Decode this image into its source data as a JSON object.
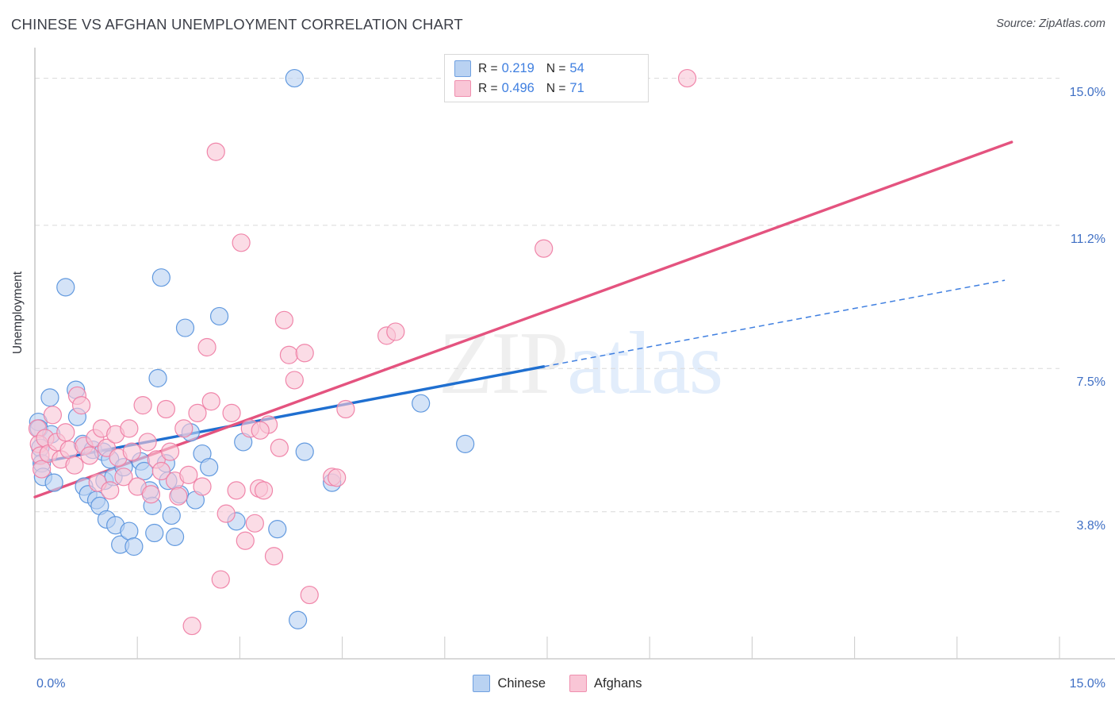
{
  "header": {
    "title": "CHINESE VS AFGHAN UNEMPLOYMENT CORRELATION CHART",
    "source": "Source: ZipAtlas.com"
  },
  "watermark": {
    "part1": "ZIP",
    "part2": "atlas"
  },
  "stats_legend": {
    "rows": [
      {
        "color": "#b9d2f2",
        "r_label": "R =",
        "r_value": "0.219",
        "n_label": "N =",
        "n_value": "54"
      },
      {
        "color": "#f9c6d6",
        "r_label": "R =",
        "r_value": "0.496",
        "n_label": "N =",
        "n_value": "71"
      }
    ]
  },
  "series_legend": {
    "items": [
      {
        "label": "Chinese",
        "color": "#b9d2f2"
      },
      {
        "label": "Afghans",
        "color": "#f9c6d6"
      }
    ]
  },
  "chart_data": {
    "type": "scatter",
    "title": "CHINESE VS AFGHAN UNEMPLOYMENT CORRELATION CHART",
    "xlabel": "",
    "ylabel": "Unemployment",
    "xlim": [
      0.0,
      15.0
    ],
    "ylim": [
      0.0,
      15.75
    ],
    "grid": true,
    "legend_position": "bottom-center",
    "x_tick_labels": [
      "0.0%",
      "15.0%"
    ],
    "y_tick_labels": [
      "3.8%",
      "7.5%",
      "11.2%",
      "15.0%"
    ],
    "y_tick_values": [
      3.8,
      7.5,
      11.2,
      15.0
    ],
    "series": [
      {
        "name": "Chinese",
        "color": "#b9d2f2",
        "stroke": "#5b95dd",
        "r": 0.219,
        "n": 54,
        "trendline": {
          "x0": 0.0,
          "y0": 5.05,
          "x1": 7.45,
          "y1": 7.55,
          "style": "solid",
          "color": "#1f6fd0"
        },
        "trendline_extension": {
          "x0": 7.45,
          "y0": 7.55,
          "x1": 14.2,
          "y1": 9.78,
          "style": "dashed",
          "color": "#3f7fe0"
        },
        "points": [
          {
            "x": 0.05,
            "y": 6.12
          },
          {
            "x": 0.06,
            "y": 5.95
          },
          {
            "x": 0.08,
            "y": 5.45
          },
          {
            "x": 0.1,
            "y": 5.05
          },
          {
            "x": 0.12,
            "y": 4.7
          },
          {
            "x": 0.22,
            "y": 6.75
          },
          {
            "x": 0.24,
            "y": 5.8
          },
          {
            "x": 0.28,
            "y": 4.55
          },
          {
            "x": 0.45,
            "y": 9.6
          },
          {
            "x": 0.6,
            "y": 6.95
          },
          {
            "x": 0.62,
            "y": 6.25
          },
          {
            "x": 0.7,
            "y": 5.55
          },
          {
            "x": 0.72,
            "y": 4.45
          },
          {
            "x": 0.78,
            "y": 4.25
          },
          {
            "x": 0.85,
            "y": 5.4
          },
          {
            "x": 0.9,
            "y": 4.1
          },
          {
            "x": 0.95,
            "y": 3.95
          },
          {
            "x": 1.0,
            "y": 5.35
          },
          {
            "x": 1.02,
            "y": 4.6
          },
          {
            "x": 1.05,
            "y": 3.6
          },
          {
            "x": 1.1,
            "y": 5.15
          },
          {
            "x": 1.15,
            "y": 4.7
          },
          {
            "x": 1.18,
            "y": 3.45
          },
          {
            "x": 1.25,
            "y": 2.95
          },
          {
            "x": 1.3,
            "y": 4.95
          },
          {
            "x": 1.38,
            "y": 3.3
          },
          {
            "x": 1.45,
            "y": 2.9
          },
          {
            "x": 1.55,
            "y": 5.1
          },
          {
            "x": 1.6,
            "y": 4.85
          },
          {
            "x": 1.68,
            "y": 4.35
          },
          {
            "x": 1.72,
            "y": 3.95
          },
          {
            "x": 1.75,
            "y": 3.25
          },
          {
            "x": 1.8,
            "y": 7.25
          },
          {
            "x": 1.85,
            "y": 9.85
          },
          {
            "x": 1.92,
            "y": 5.05
          },
          {
            "x": 1.95,
            "y": 4.6
          },
          {
            "x": 2.0,
            "y": 3.7
          },
          {
            "x": 2.05,
            "y": 3.15
          },
          {
            "x": 2.12,
            "y": 4.25
          },
          {
            "x": 2.2,
            "y": 8.55
          },
          {
            "x": 2.28,
            "y": 5.85
          },
          {
            "x": 2.35,
            "y": 4.1
          },
          {
            "x": 2.45,
            "y": 5.3
          },
          {
            "x": 2.55,
            "y": 4.95
          },
          {
            "x": 2.7,
            "y": 8.85
          },
          {
            "x": 2.95,
            "y": 3.55
          },
          {
            "x": 3.05,
            "y": 5.6
          },
          {
            "x": 3.55,
            "y": 3.35
          },
          {
            "x": 3.8,
            "y": 15.0
          },
          {
            "x": 3.85,
            "y": 1.0
          },
          {
            "x": 3.95,
            "y": 5.35
          },
          {
            "x": 4.35,
            "y": 4.55
          },
          {
            "x": 5.65,
            "y": 6.6
          },
          {
            "x": 6.3,
            "y": 5.55
          }
        ]
      },
      {
        "name": "Afghans",
        "color": "#f9c6d6",
        "stroke": "#ef7fa5",
        "r": 0.496,
        "n": 71,
        "trendline": {
          "x0": 0.0,
          "y0": 4.18,
          "x1": 14.3,
          "y1": 13.35,
          "style": "solid",
          "color": "#e4537f"
        },
        "points": [
          {
            "x": 0.04,
            "y": 5.95
          },
          {
            "x": 0.06,
            "y": 5.55
          },
          {
            "x": 0.08,
            "y": 5.25
          },
          {
            "x": 0.1,
            "y": 4.9
          },
          {
            "x": 0.15,
            "y": 5.7
          },
          {
            "x": 0.2,
            "y": 5.3
          },
          {
            "x": 0.26,
            "y": 6.3
          },
          {
            "x": 0.32,
            "y": 5.6
          },
          {
            "x": 0.38,
            "y": 5.15
          },
          {
            "x": 0.45,
            "y": 5.85
          },
          {
            "x": 0.5,
            "y": 5.4
          },
          {
            "x": 0.58,
            "y": 5.0
          },
          {
            "x": 0.62,
            "y": 6.8
          },
          {
            "x": 0.68,
            "y": 6.55
          },
          {
            "x": 0.72,
            "y": 5.5
          },
          {
            "x": 0.8,
            "y": 5.25
          },
          {
            "x": 0.88,
            "y": 5.7
          },
          {
            "x": 0.92,
            "y": 4.55
          },
          {
            "x": 0.98,
            "y": 5.95
          },
          {
            "x": 1.05,
            "y": 5.45
          },
          {
            "x": 1.1,
            "y": 4.35
          },
          {
            "x": 1.18,
            "y": 5.8
          },
          {
            "x": 1.22,
            "y": 5.2
          },
          {
            "x": 1.3,
            "y": 4.7
          },
          {
            "x": 1.38,
            "y": 5.95
          },
          {
            "x": 1.42,
            "y": 5.35
          },
          {
            "x": 1.5,
            "y": 4.45
          },
          {
            "x": 1.58,
            "y": 6.55
          },
          {
            "x": 1.65,
            "y": 5.6
          },
          {
            "x": 1.7,
            "y": 4.25
          },
          {
            "x": 1.78,
            "y": 5.15
          },
          {
            "x": 1.85,
            "y": 4.85
          },
          {
            "x": 1.92,
            "y": 6.45
          },
          {
            "x": 1.98,
            "y": 5.35
          },
          {
            "x": 2.05,
            "y": 4.6
          },
          {
            "x": 2.1,
            "y": 4.2
          },
          {
            "x": 2.18,
            "y": 5.95
          },
          {
            "x": 2.25,
            "y": 4.75
          },
          {
            "x": 2.3,
            "y": 0.85
          },
          {
            "x": 2.38,
            "y": 6.35
          },
          {
            "x": 2.45,
            "y": 4.45
          },
          {
            "x": 2.52,
            "y": 8.05
          },
          {
            "x": 2.58,
            "y": 6.65
          },
          {
            "x": 2.65,
            "y": 13.1
          },
          {
            "x": 2.72,
            "y": 2.05
          },
          {
            "x": 2.8,
            "y": 3.75
          },
          {
            "x": 2.88,
            "y": 6.35
          },
          {
            "x": 2.95,
            "y": 4.35
          },
          {
            "x": 3.02,
            "y": 10.75
          },
          {
            "x": 3.08,
            "y": 3.05
          },
          {
            "x": 3.15,
            "y": 5.95
          },
          {
            "x": 3.22,
            "y": 3.5
          },
          {
            "x": 3.28,
            "y": 4.4
          },
          {
            "x": 3.35,
            "y": 4.35
          },
          {
            "x": 3.42,
            "y": 6.05
          },
          {
            "x": 3.5,
            "y": 2.65
          },
          {
            "x": 3.58,
            "y": 5.45
          },
          {
            "x": 3.65,
            "y": 8.75
          },
          {
            "x": 3.72,
            "y": 7.85
          },
          {
            "x": 3.8,
            "y": 7.2
          },
          {
            "x": 3.95,
            "y": 7.9
          },
          {
            "x": 4.02,
            "y": 1.65
          },
          {
            "x": 4.35,
            "y": 4.7
          },
          {
            "x": 4.42,
            "y": 4.68
          },
          {
            "x": 4.55,
            "y": 6.45
          },
          {
            "x": 5.15,
            "y": 8.35
          },
          {
            "x": 5.28,
            "y": 8.45
          },
          {
            "x": 7.45,
            "y": 10.6
          },
          {
            "x": 9.55,
            "y": 15.0
          },
          {
            "x": 3.3,
            "y": 5.9
          }
        ]
      }
    ]
  }
}
